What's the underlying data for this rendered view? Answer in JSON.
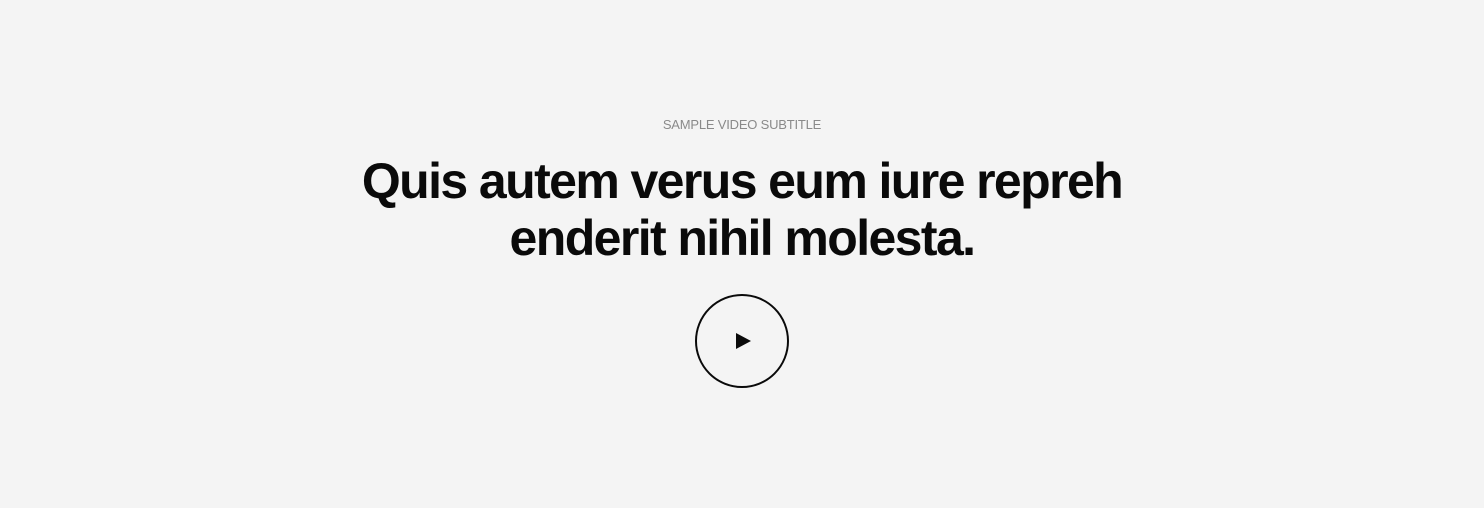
{
  "video": {
    "subtitle": "SAMPLE VIDEO SUBTITLE",
    "headline_line1": "Quis autem verus eum iure repreh",
    "headline_line2": "enderit nihil molesta.",
    "play_icon": "play-icon"
  },
  "colors": {
    "background": "#f4f4f4",
    "text": "#0a0a0a",
    "subtitle": "#8a8a8a"
  }
}
